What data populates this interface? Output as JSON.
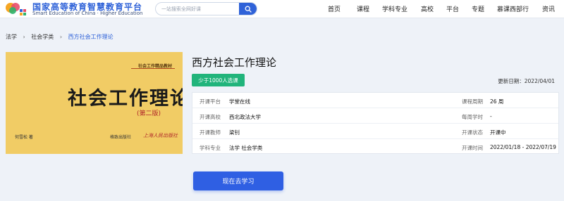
{
  "header": {
    "logo_cn": "国家高等教育智慧教育平台",
    "logo_en": "Smart Education of China · Higher Education",
    "search": {
      "placeholder": "一站搜索全网好课",
      "icon": "search-icon"
    },
    "nav": [
      "首页",
      "课程",
      "学科专业",
      "高校",
      "平台",
      "专题",
      "慕课西部行",
      "资讯"
    ]
  },
  "breadcrumb": [
    "法学",
    "社会学类",
    "西方社会工作理论"
  ],
  "cover": {
    "series": "社会工作精品教材",
    "title": "社会工作理论",
    "edition": "(第二版)",
    "author": "何雪松 著",
    "press": "格致出版社",
    "press2": "上海人民出版社"
  },
  "course": {
    "title": "西方社会工作理论",
    "badge": "少于1000人选课",
    "update_date": "更新日期：2022/04/01",
    "info": [
      {
        "label": "开课平台",
        "value": "学堂在线",
        "label2": "课程周期",
        "value2": "26 周"
      },
      {
        "label": "开课高校",
        "value": "西北政法大学",
        "label2": "每周学时",
        "value2": "-"
      },
      {
        "label": "开课教师",
        "value": "梁钊",
        "label2": "开课状态",
        "value2": "开课中"
      },
      {
        "label": "学科专业",
        "value": "法学 社会学类",
        "label2": "开课时间",
        "value2": "2022/01/18 - 2022/07/19"
      }
    ],
    "cta": "现在去学习"
  },
  "colors": {
    "accent": "#2f62d8",
    "badge": "#21b47b",
    "cover": "#f1cc65"
  }
}
